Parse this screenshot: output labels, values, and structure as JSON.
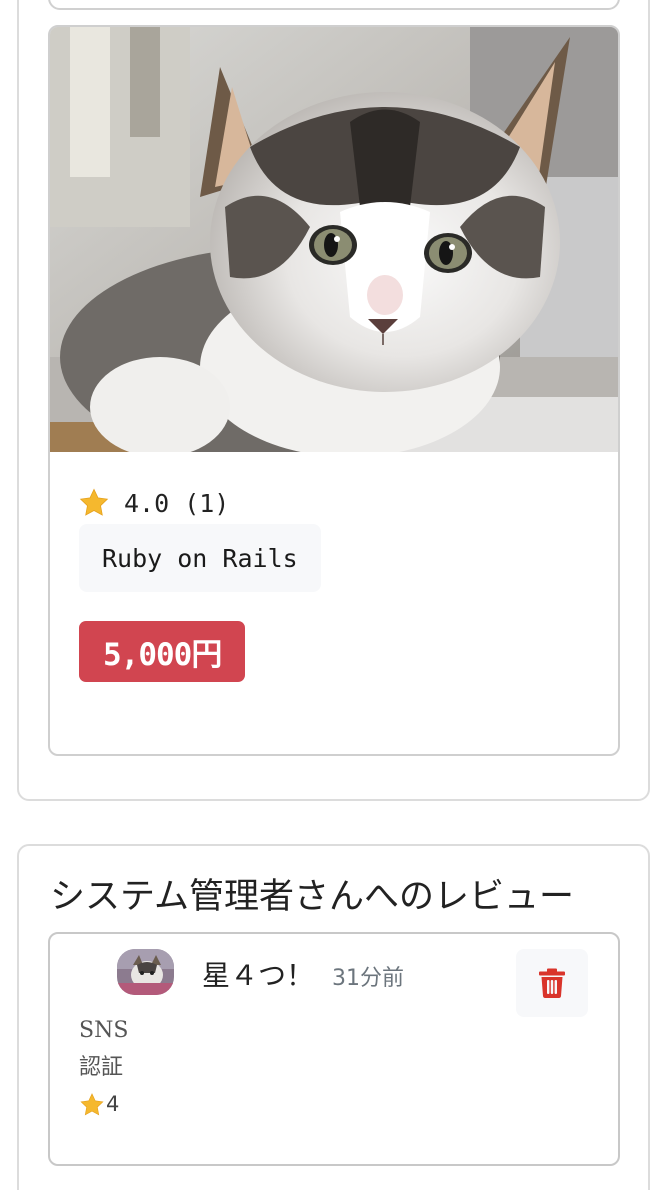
{
  "product": {
    "rating_text": "4.0 (1)",
    "tag": "Ruby on Rails",
    "price": "5,000円",
    "image": "kitten-photo",
    "star_icon": "star-icon"
  },
  "reviews_section": {
    "title": "システム管理者さんへのレビュー",
    "items": [
      {
        "title": "星４つ！",
        "time": "31分前",
        "category_line1": "SNS",
        "category_line2": "認証",
        "stars": "4",
        "avatar": "user-avatar",
        "delete_icon": "trash-icon"
      }
    ]
  },
  "colors": {
    "price_badge": "#d14550",
    "chip_bg": "#f7f8fa",
    "star": "#f5b82e",
    "trash": "#d9342b",
    "border": "#cfcfcf"
  }
}
